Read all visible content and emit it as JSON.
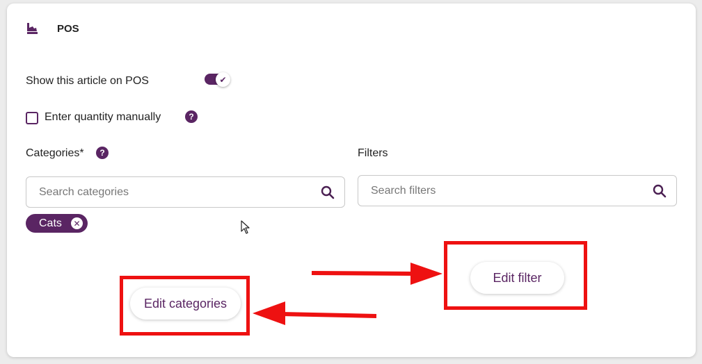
{
  "colors": {
    "accent": "#5a2563",
    "annotation": "#ee1111",
    "text": "#222222",
    "background": "#ececec"
  },
  "section": {
    "icon": "pos-register-icon",
    "title": "POS"
  },
  "show_on_pos": {
    "label": "Show this article on POS",
    "enabled": true,
    "check_glyph": "✔"
  },
  "enter_quantity": {
    "label": "Enter quantity manually",
    "checked": false,
    "help_glyph": "?"
  },
  "categories": {
    "label": "Categories*",
    "help_glyph": "?",
    "search_placeholder": "Search categories",
    "search_value": "",
    "selected": [
      {
        "label": "Cats",
        "remove_glyph": "✕"
      }
    ]
  },
  "filters": {
    "label": "Filters",
    "search_placeholder": "Search filters",
    "search_value": ""
  },
  "actions": {
    "edit_filter_label": "Edit filter",
    "edit_categories_label": "Edit categories"
  }
}
